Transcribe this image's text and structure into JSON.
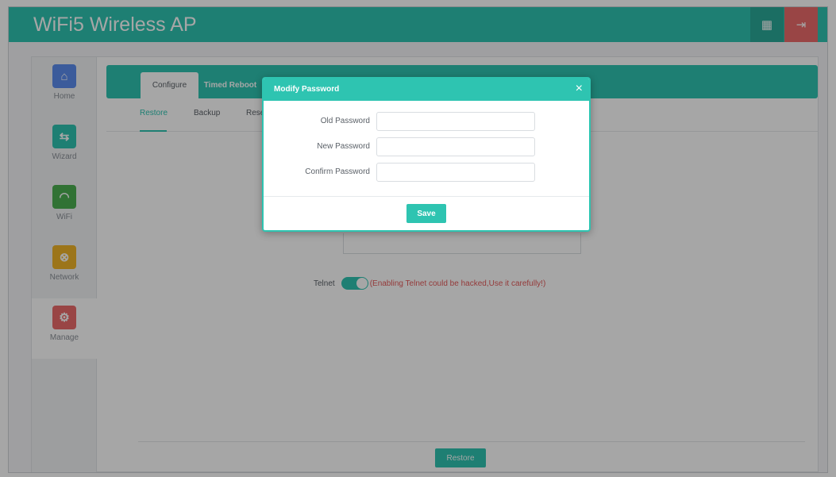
{
  "app": {
    "title": "WiFi5 Wireless AP",
    "apps_icon": "grid-icon",
    "logout_icon": "logout-icon"
  },
  "sidebar": {
    "items": [
      {
        "label": "Home",
        "icon": "home-icon",
        "color": "#5b8def",
        "glyph": "⌂"
      },
      {
        "label": "Wizard",
        "icon": "wizard-icon",
        "color": "#2ec4b1",
        "glyph": "⇆"
      },
      {
        "label": "WiFi",
        "icon": "wifi-icon",
        "color": "#4caf50",
        "glyph": "◠"
      },
      {
        "label": "Network",
        "icon": "network-icon",
        "color": "#f0b428",
        "glyph": "⊗"
      },
      {
        "label": "Manage",
        "icon": "manage-icon",
        "color": "#ec6a6a",
        "glyph": "⚙"
      }
    ],
    "active": "Manage"
  },
  "tabs": {
    "configure": "Configure",
    "timed_reboot": "Timed Reboot"
  },
  "subtabs": {
    "restore": "Restore",
    "backup": "Backup",
    "reset": "Rese"
  },
  "telnet": {
    "label": "Telnet",
    "enabled": true,
    "warning": "(Enabling Telnet could be hacked,Use it carefully!)"
  },
  "restore_button": "Restore",
  "modal": {
    "title": "Modify Password",
    "close": "×",
    "fields": [
      {
        "label": "Old Password",
        "value": ""
      },
      {
        "label": "New Password",
        "value": ""
      },
      {
        "label": "Confirm Password",
        "value": ""
      }
    ],
    "save": "Save"
  },
  "colors": {
    "accent": "#2ec4b1",
    "danger": "#ec6a6a"
  }
}
